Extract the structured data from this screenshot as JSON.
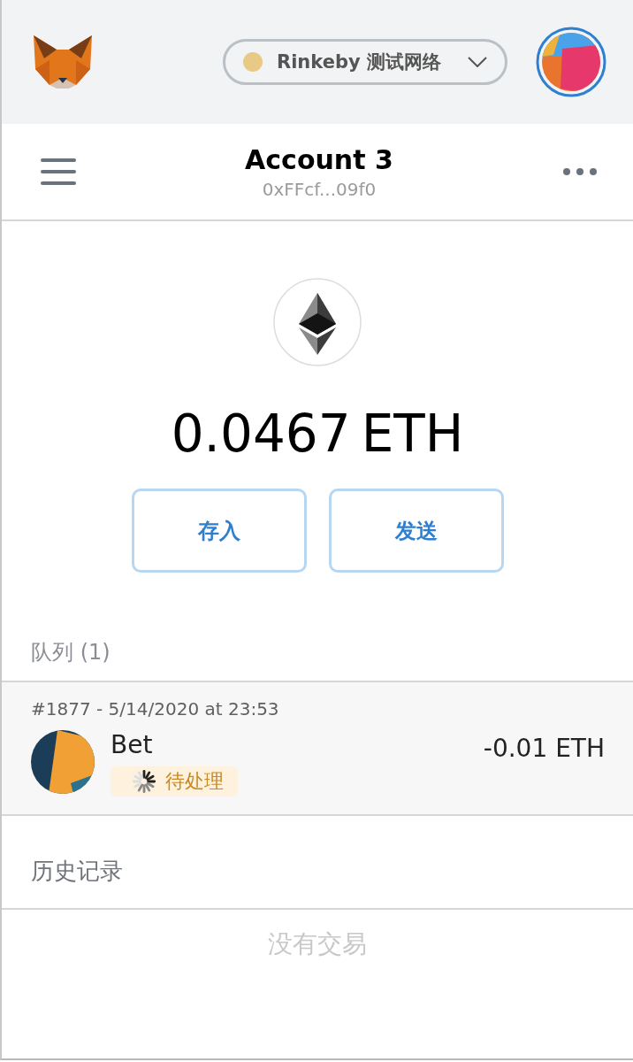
{
  "header": {
    "network": "Rinkeby 测试网络"
  },
  "account": {
    "name": "Account 3",
    "address": "0xFFcf...09f0"
  },
  "balance": {
    "amount": "0.0467",
    "unit": "ETH"
  },
  "buttons": [
    "存入",
    "发送"
  ],
  "queue": {
    "title": "队列 (1)",
    "transactions": [
      {
        "meta": "#1877 - 5/14/2020 at 23:53",
        "title": "Bet",
        "amount": "-0.01 ETH",
        "status": "待处理"
      }
    ]
  },
  "history": {
    "title": "历史记录",
    "empty": "没有交易"
  }
}
